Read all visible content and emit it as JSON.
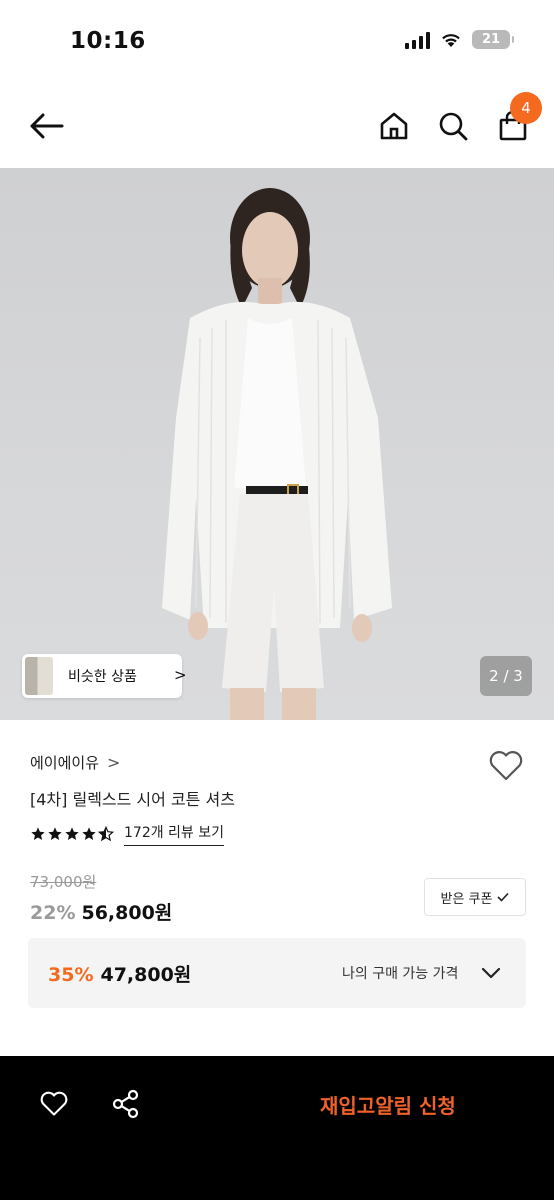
{
  "status_bar": {
    "time": "10:16",
    "battery_level": "21"
  },
  "nav": {
    "back_icon": "arrow-left-icon",
    "home_icon": "home-icon",
    "search_icon": "search-icon",
    "cart_icon": "shopping-bag-icon",
    "cart_badge": "4"
  },
  "gallery": {
    "similar_label": "비슷한 상품",
    "similar_chevron": ">",
    "page_indicator": "2 / 3",
    "current_page": 2,
    "total_pages": 3
  },
  "product": {
    "brand": "에이에이유",
    "brand_chevron": ">",
    "title": "[4차] 릴렉스드 시어 코튼 셔츠",
    "rating": 4.5,
    "review_link": "172개 리뷰 보기",
    "original_price": "73,000원",
    "discount": "22%",
    "sale_price": "56,800원",
    "coupon_label": "받은 쿠폰"
  },
  "my_price": {
    "discount": "35%",
    "price": "47,800원",
    "label": "나의 구매 가능 가격"
  },
  "bottom_bar": {
    "restock_label": "재입고알림 신청"
  },
  "colors": {
    "accent": "#f46a1e",
    "restock": "#f0622a",
    "bottom_bg": "#000000",
    "my_price_bg": "#f4f4f4"
  }
}
